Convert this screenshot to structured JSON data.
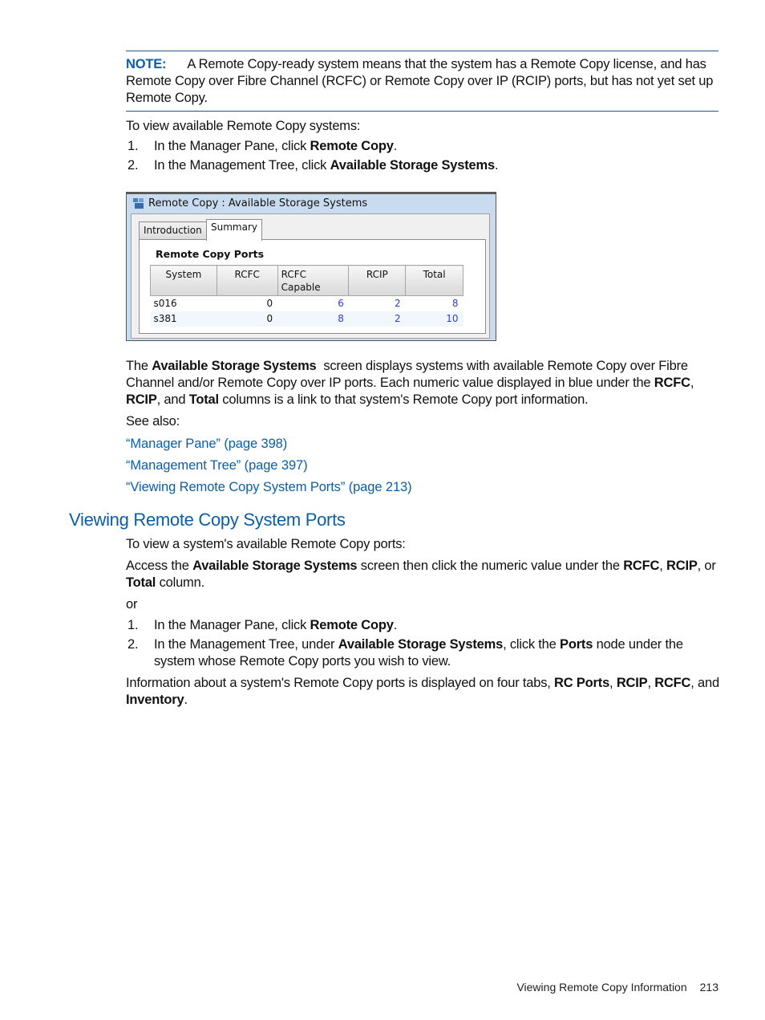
{
  "note": {
    "label": "NOTE:",
    "text": "A Remote Copy-ready system means that the system has a Remote Copy license, and has Remote Copy over Fibre Channel (RCFC) or Remote Copy over IP (RCIP) ports, but has not yet set up Remote Copy."
  },
  "intro": "To view available Remote Copy systems:",
  "steps1": [
    {
      "num": "1.",
      "pre": "In the Manager Pane, click ",
      "bold": "Remote Copy",
      "post": "."
    },
    {
      "num": "2.",
      "pre": "In the Management Tree, click ",
      "bold": "Available Storage Systems",
      "post": "."
    }
  ],
  "window": {
    "title": "Remote Copy : Available Storage Systems",
    "icon": "network-storage-icon",
    "tabs": [
      {
        "label": "Introduction",
        "active": false
      },
      {
        "label": "Summary",
        "active": true
      }
    ],
    "panel_title": "Remote Copy Ports",
    "columns": [
      "System",
      "RCFC",
      "RCFC\nCapable",
      "RCIP",
      "Total"
    ],
    "column_lines": [
      [
        "System"
      ],
      [
        "RCFC"
      ],
      [
        "RCFC",
        "Capable"
      ],
      [
        "RCIP"
      ],
      [
        "Total"
      ]
    ],
    "rows": [
      {
        "system": "s016",
        "rcfc": "0",
        "rcfc_capable": "6",
        "rcip": "2",
        "total": "8"
      },
      {
        "system": "s381",
        "rcfc": "0",
        "rcfc_capable": "8",
        "rcip": "2",
        "total": "10"
      }
    ],
    "link_color": "#2a3fd4"
  },
  "desc": {
    "p1_a": "The ",
    "p1_b": "Available Storage Systems",
    "p1_c": "  screen displays systems with available Remote Copy over Fibre Channel and/or Remote Copy over IP ports. Each numeric value displayed in blue under the ",
    "p1_d": "RCFC",
    "p1_e": ", ",
    "p1_f": "RCIP",
    "p1_g": ", and ",
    "p1_h": "Total",
    "p1_i": " columns is a link to that system's Remote Copy port information."
  },
  "see_also": {
    "label": "See also:",
    "links": [
      "“Manager Pane” (page 398)",
      "“Management Tree” (page 397)",
      "“Viewing Remote Copy System Ports” (page 213)"
    ]
  },
  "section": {
    "heading": "Viewing Remote Copy System Ports",
    "intro": "To view a system's available Remote Copy ports:",
    "access_a": "Access the ",
    "access_b": "Available Storage Systems",
    "access_c": " screen then click the numeric value under the ",
    "access_d": "RCFC",
    "access_e": ", ",
    "access_f": "RCIP",
    "access_g": ", or ",
    "access_h": "Total",
    "access_i": " column.",
    "or": "or",
    "steps": [
      {
        "num": "1.",
        "pre": "In the Manager Pane, click ",
        "bold": "Remote Copy",
        "mid": "",
        "bold2": "",
        "post": "."
      },
      {
        "num": "2.",
        "pre": "In the Management Tree, under ",
        "bold": "Available Storage Systems",
        "mid": ", click the ",
        "bold2": "Ports",
        "post": " node under the system whose Remote Copy ports you wish to view."
      }
    ],
    "info_a": "Information about a system's Remote Copy ports is displayed on four tabs, ",
    "info_b": "RC Ports",
    "info_c": ", ",
    "info_d": "RCIP",
    "info_e": ", ",
    "info_f": "RCFC",
    "info_g": ", and ",
    "info_h": "Inventory",
    "info_i": "."
  },
  "footer": {
    "section": "Viewing Remote Copy Information",
    "page": "213"
  },
  "colors": {
    "accent_blue": "#0b5ea6",
    "rule": "#1f5a8a"
  }
}
